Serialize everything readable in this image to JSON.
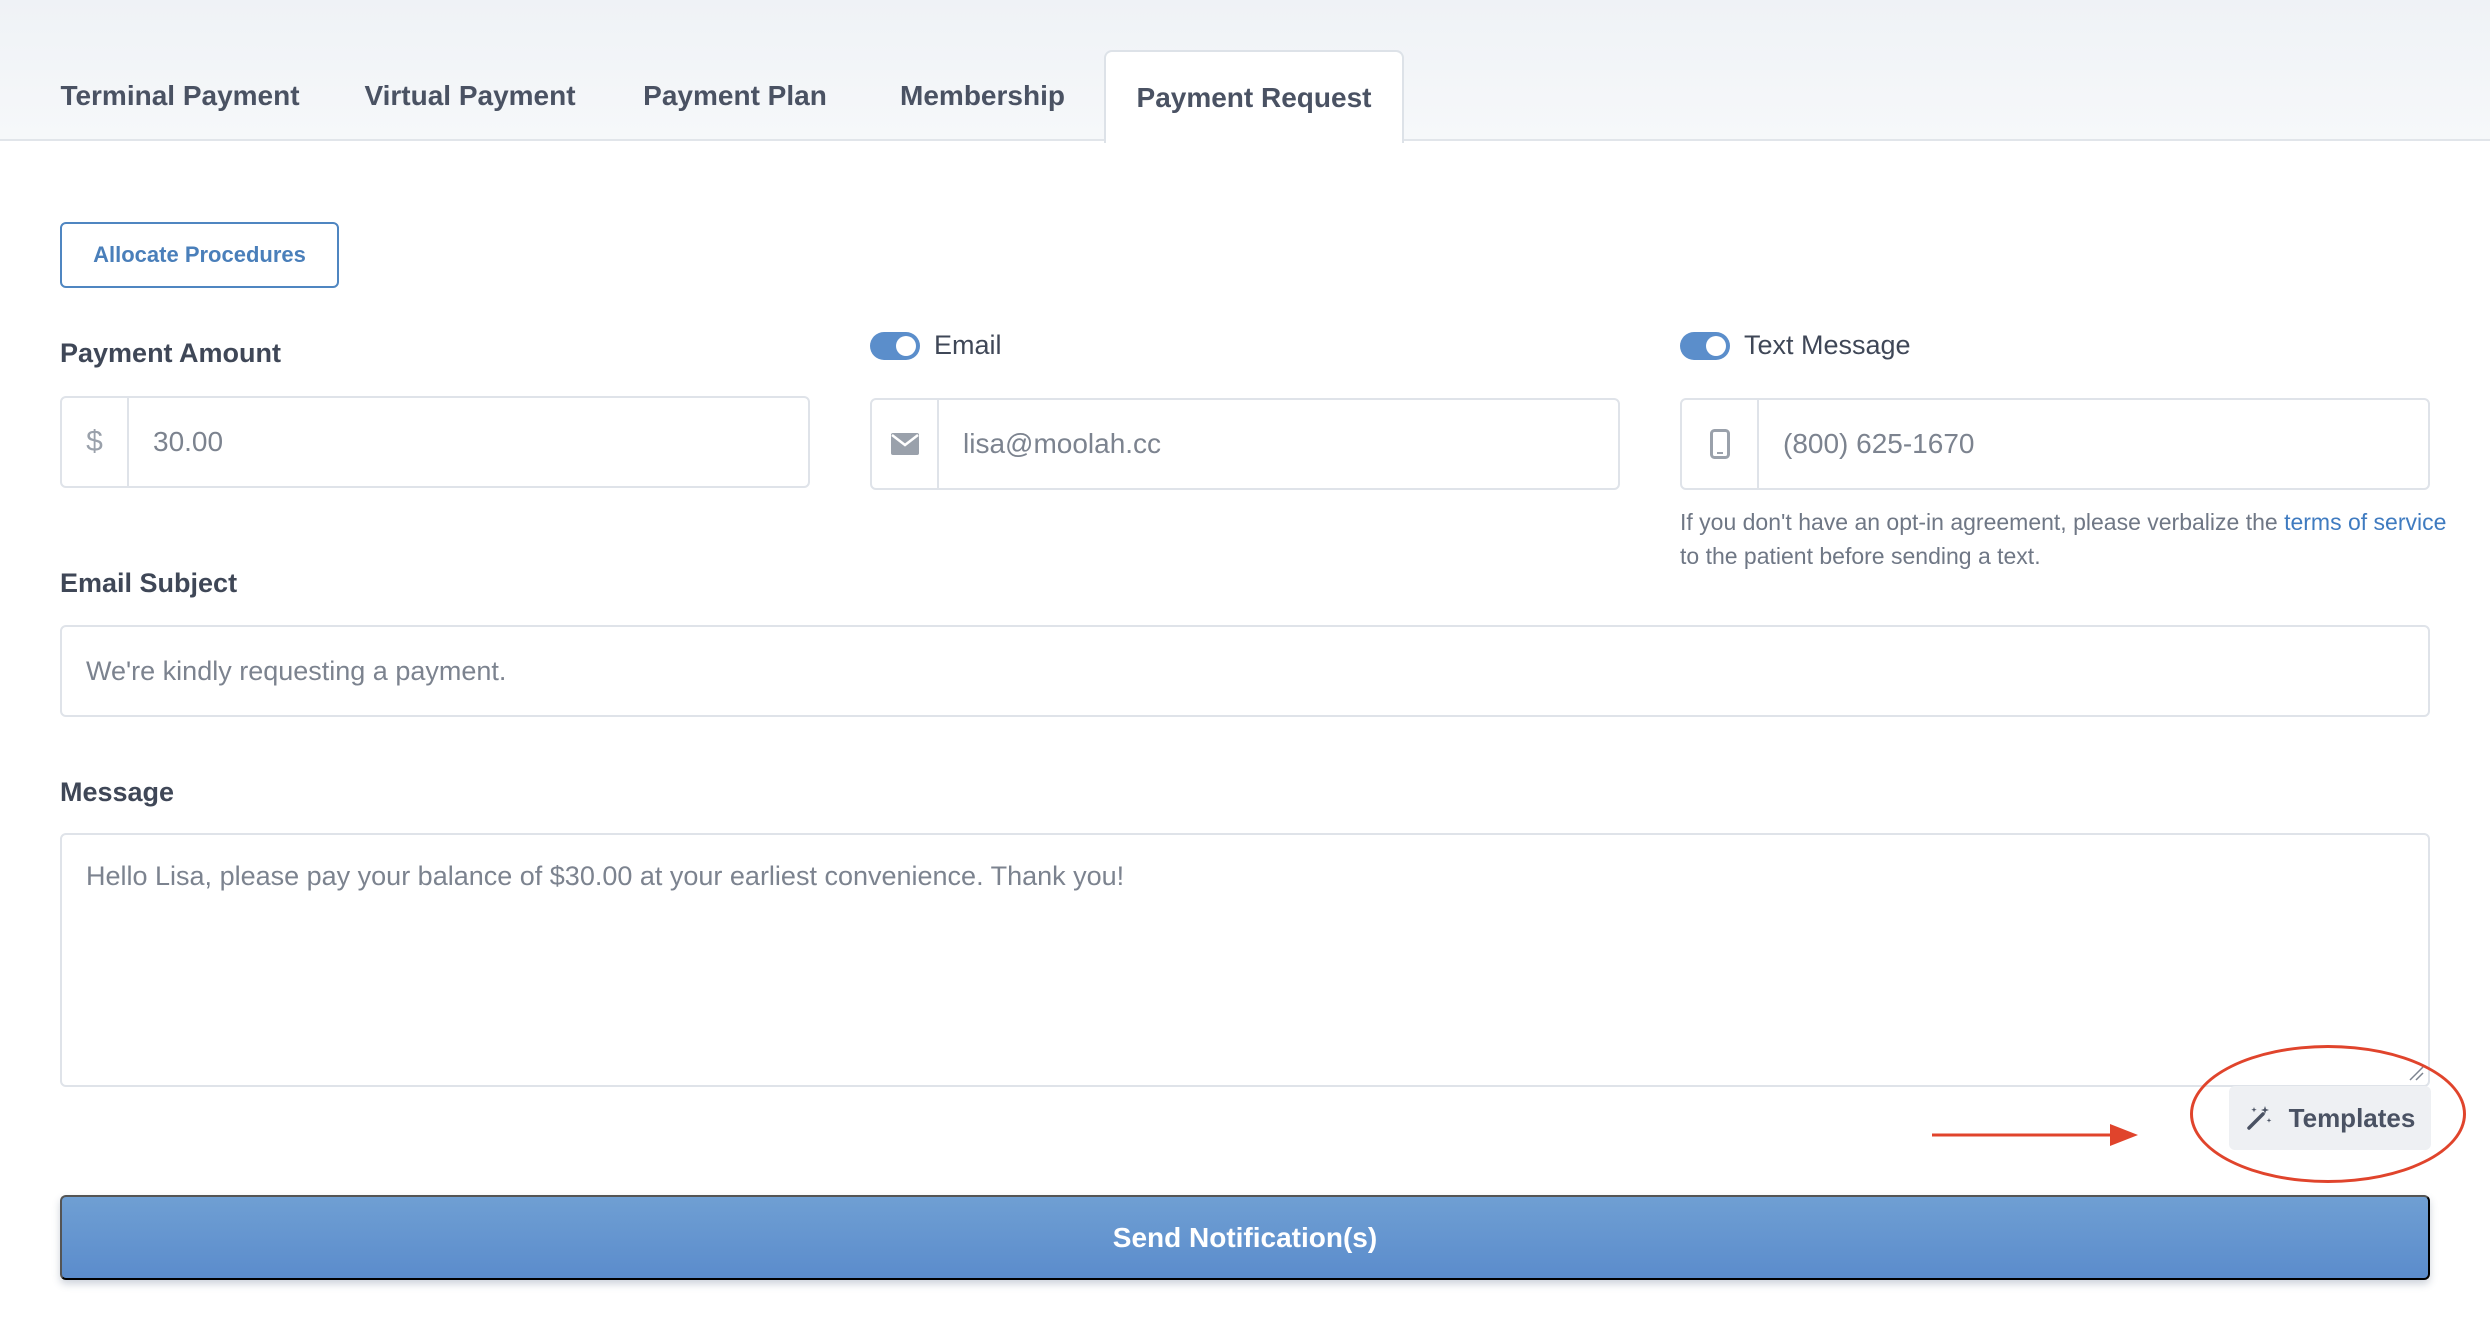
{
  "tabs": [
    {
      "label": "Terminal Payment"
    },
    {
      "label": "Virtual Payment"
    },
    {
      "label": "Payment Plan"
    },
    {
      "label": "Membership"
    },
    {
      "label": "Payment Request",
      "active": true
    }
  ],
  "allocate_button": "Allocate Procedures",
  "payment_amount": {
    "label": "Payment Amount",
    "currency_symbol": "$",
    "value": "30.00"
  },
  "email": {
    "label": "Email",
    "enabled": true,
    "value": "lisa@moolah.cc",
    "icon": "envelope-icon"
  },
  "text_message": {
    "label": "Text Message",
    "enabled": true,
    "value": "(800) 625-1670",
    "icon": "phone-icon",
    "helper_before": "If you don't have an opt-in agreement, please verbalize the ",
    "helper_link": "terms of service",
    "helper_after": " to the patient before sending a text."
  },
  "email_subject": {
    "label": "Email Subject",
    "value": "We're kindly requesting a payment."
  },
  "message": {
    "label": "Message",
    "value": "Hello Lisa, please pay your balance of $30.00 at your earliest convenience. Thank you!"
  },
  "templates_button": "Templates",
  "send_button": "Send Notification(s)",
  "colors": {
    "accent": "#5b8ecb",
    "annotation": "#e0442c"
  }
}
